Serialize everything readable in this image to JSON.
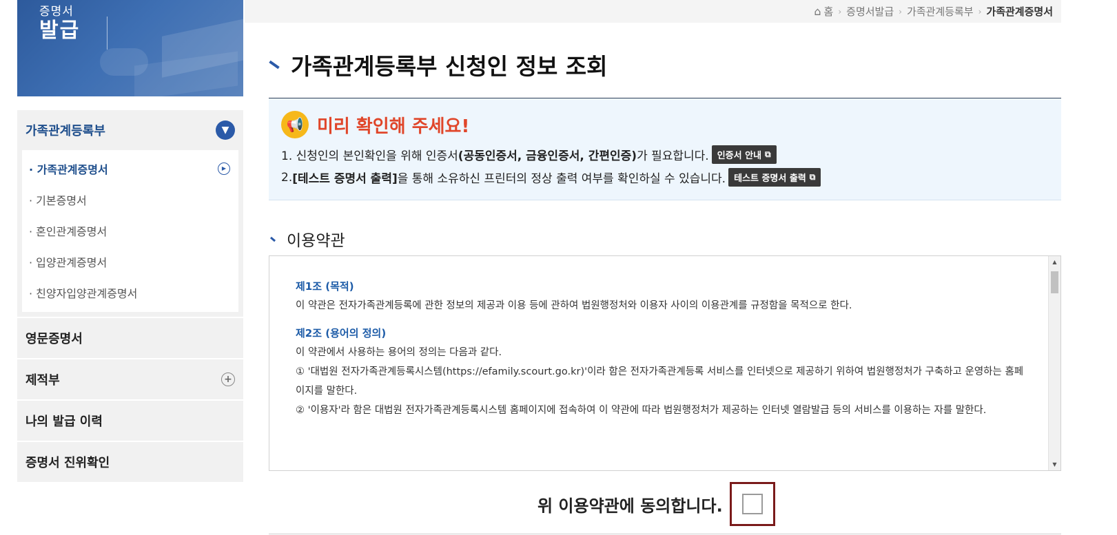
{
  "banner": {
    "small": "증명서",
    "big": "발급"
  },
  "sidebar": {
    "groups": [
      {
        "label": "가족관계등록부"
      },
      {
        "label": "영문증명서"
      },
      {
        "label": "제적부"
      },
      {
        "label": "나의 발급 이력"
      },
      {
        "label": "증명서 진위확인"
      }
    ],
    "sub_items": [
      {
        "label": "· 가족관계증명서"
      },
      {
        "label": "· 기본증명서"
      },
      {
        "label": "· 혼인관계증명서"
      },
      {
        "label": "· 입양관계증명서"
      },
      {
        "label": "· 친양자입양관계증명서"
      }
    ]
  },
  "breadcrumb": {
    "items": [
      "홈",
      "증명서발급",
      "가족관계등록부"
    ],
    "current": "가족관계증명서"
  },
  "page_title": "가족관계등록부 신청인 정보 조회",
  "notice": {
    "title": "미리 확인해 주세요!",
    "line1_pre": "1. 신청인의 본인확인을 위해 인증서",
    "line1_bold": "(공동인증서, 금융인증서, 간편인증)",
    "line1_post": "가 필요합니다.",
    "line1_button": "인증서 안내",
    "line2_pre": "2.",
    "line2_bold": "[테스트 증명서 출력]",
    "line2_post": "을 통해 소유하신 프린터의 정상 출력 여부를 확인하실 수 있습니다.",
    "line2_button": "테스트 증명서 출력"
  },
  "terms": {
    "section_title": "이용약관",
    "art1_title": "제1조 (목적)",
    "art1_body": "이 약관은 전자가족관계등록에 관한 정보의 제공과 이용 등에 관하여 법원행정처와 이용자 사이의 이용관계를 규정함을 목적으로 한다.",
    "art2_title": "제2조 (용어의 정의)",
    "art2_intro": "이 약관에서 사용하는 용어의 정의는 다음과 같다.",
    "art2_item1": "① '대법원 전자가족관계등록시스템(https://efamily.scourt.go.kr)'이라 함은 전자가족관계등록 서비스를 인터넷으로 제공하기 위하여 법원행정처가 구축하고 운영하는 홈페이지를 말한다.",
    "art2_item2": "② '이용자'라 함은 대법원 전자가족관계등록시스템 홈페이지에 접속하여 이 약관에 따라 법원행정처가 제공하는 인터넷 열람발급 등의 서비스를 이용하는 자를 말한다."
  },
  "agree": {
    "label": "위 이용약관에 동의합니다."
  },
  "icons": {
    "home": "home-icon",
    "chevron_down": "chevron-down-icon",
    "arrow_right": "arrow-right-icon",
    "plus": "plus-icon",
    "megaphone": "megaphone-icon",
    "external": "external-link-icon"
  },
  "colors": {
    "accent": "#2b5aa8",
    "notice_title": "#e0462a",
    "notice_bg": "#eef6fd",
    "agree_border": "#7a1a1a"
  }
}
